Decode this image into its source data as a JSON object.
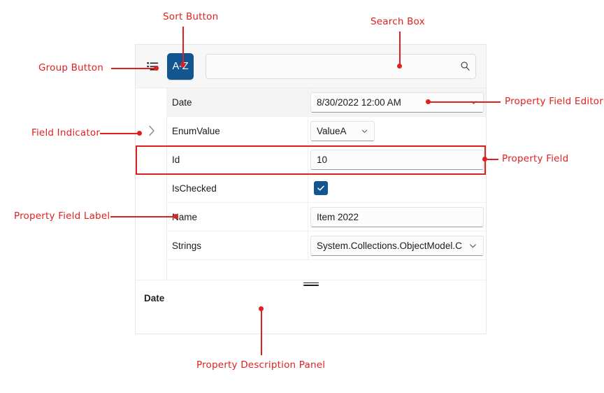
{
  "toolbar": {
    "group_button": {
      "icon": "group-list-icon",
      "tooltip": "Group"
    },
    "sort_button": {
      "label": "A-Z",
      "icon": "sort-az-icon",
      "color": "#12558f"
    },
    "search": {
      "value": "",
      "placeholder": "",
      "icon": "search-icon"
    }
  },
  "grid": {
    "rows": [
      {
        "label": "Date",
        "editor": "datetime",
        "value": "8/30/2022 12:00 AM",
        "selected": true,
        "indicator": false,
        "highlighted": false
      },
      {
        "label": "EnumValue",
        "editor": "combo",
        "value": "ValueA",
        "selected": false,
        "indicator": true,
        "highlighted": false
      },
      {
        "label": "Id",
        "editor": "text",
        "value": "10",
        "selected": false,
        "indicator": false,
        "highlighted": true
      },
      {
        "label": "IsChecked",
        "editor": "checkbox",
        "value": "checked",
        "selected": false,
        "indicator": false,
        "highlighted": false
      },
      {
        "label": "Name",
        "editor": "text",
        "value": "Item 2022",
        "selected": false,
        "indicator": false,
        "highlighted": false
      },
      {
        "label": "Strings",
        "editor": "combo-wide",
        "value": "System.Collections.ObjectModel.C",
        "selected": false,
        "indicator": false,
        "highlighted": false
      }
    ]
  },
  "description": {
    "title": "Date",
    "text": ""
  },
  "annotations": {
    "accent_color": "#e02020",
    "items": [
      {
        "id": "group-button",
        "label": "Group Button"
      },
      {
        "id": "sort-button",
        "label": "Sort Button"
      },
      {
        "id": "search-box",
        "label": "Search Box"
      },
      {
        "id": "property-field-editor",
        "label": "Property Field Editor"
      },
      {
        "id": "field-indicator",
        "label": "Field Indicator"
      },
      {
        "id": "property-field",
        "label": "Property Field"
      },
      {
        "id": "property-field-label",
        "label": "Property Field Label"
      },
      {
        "id": "property-description-panel",
        "label": "Property Description Panel"
      }
    ]
  }
}
